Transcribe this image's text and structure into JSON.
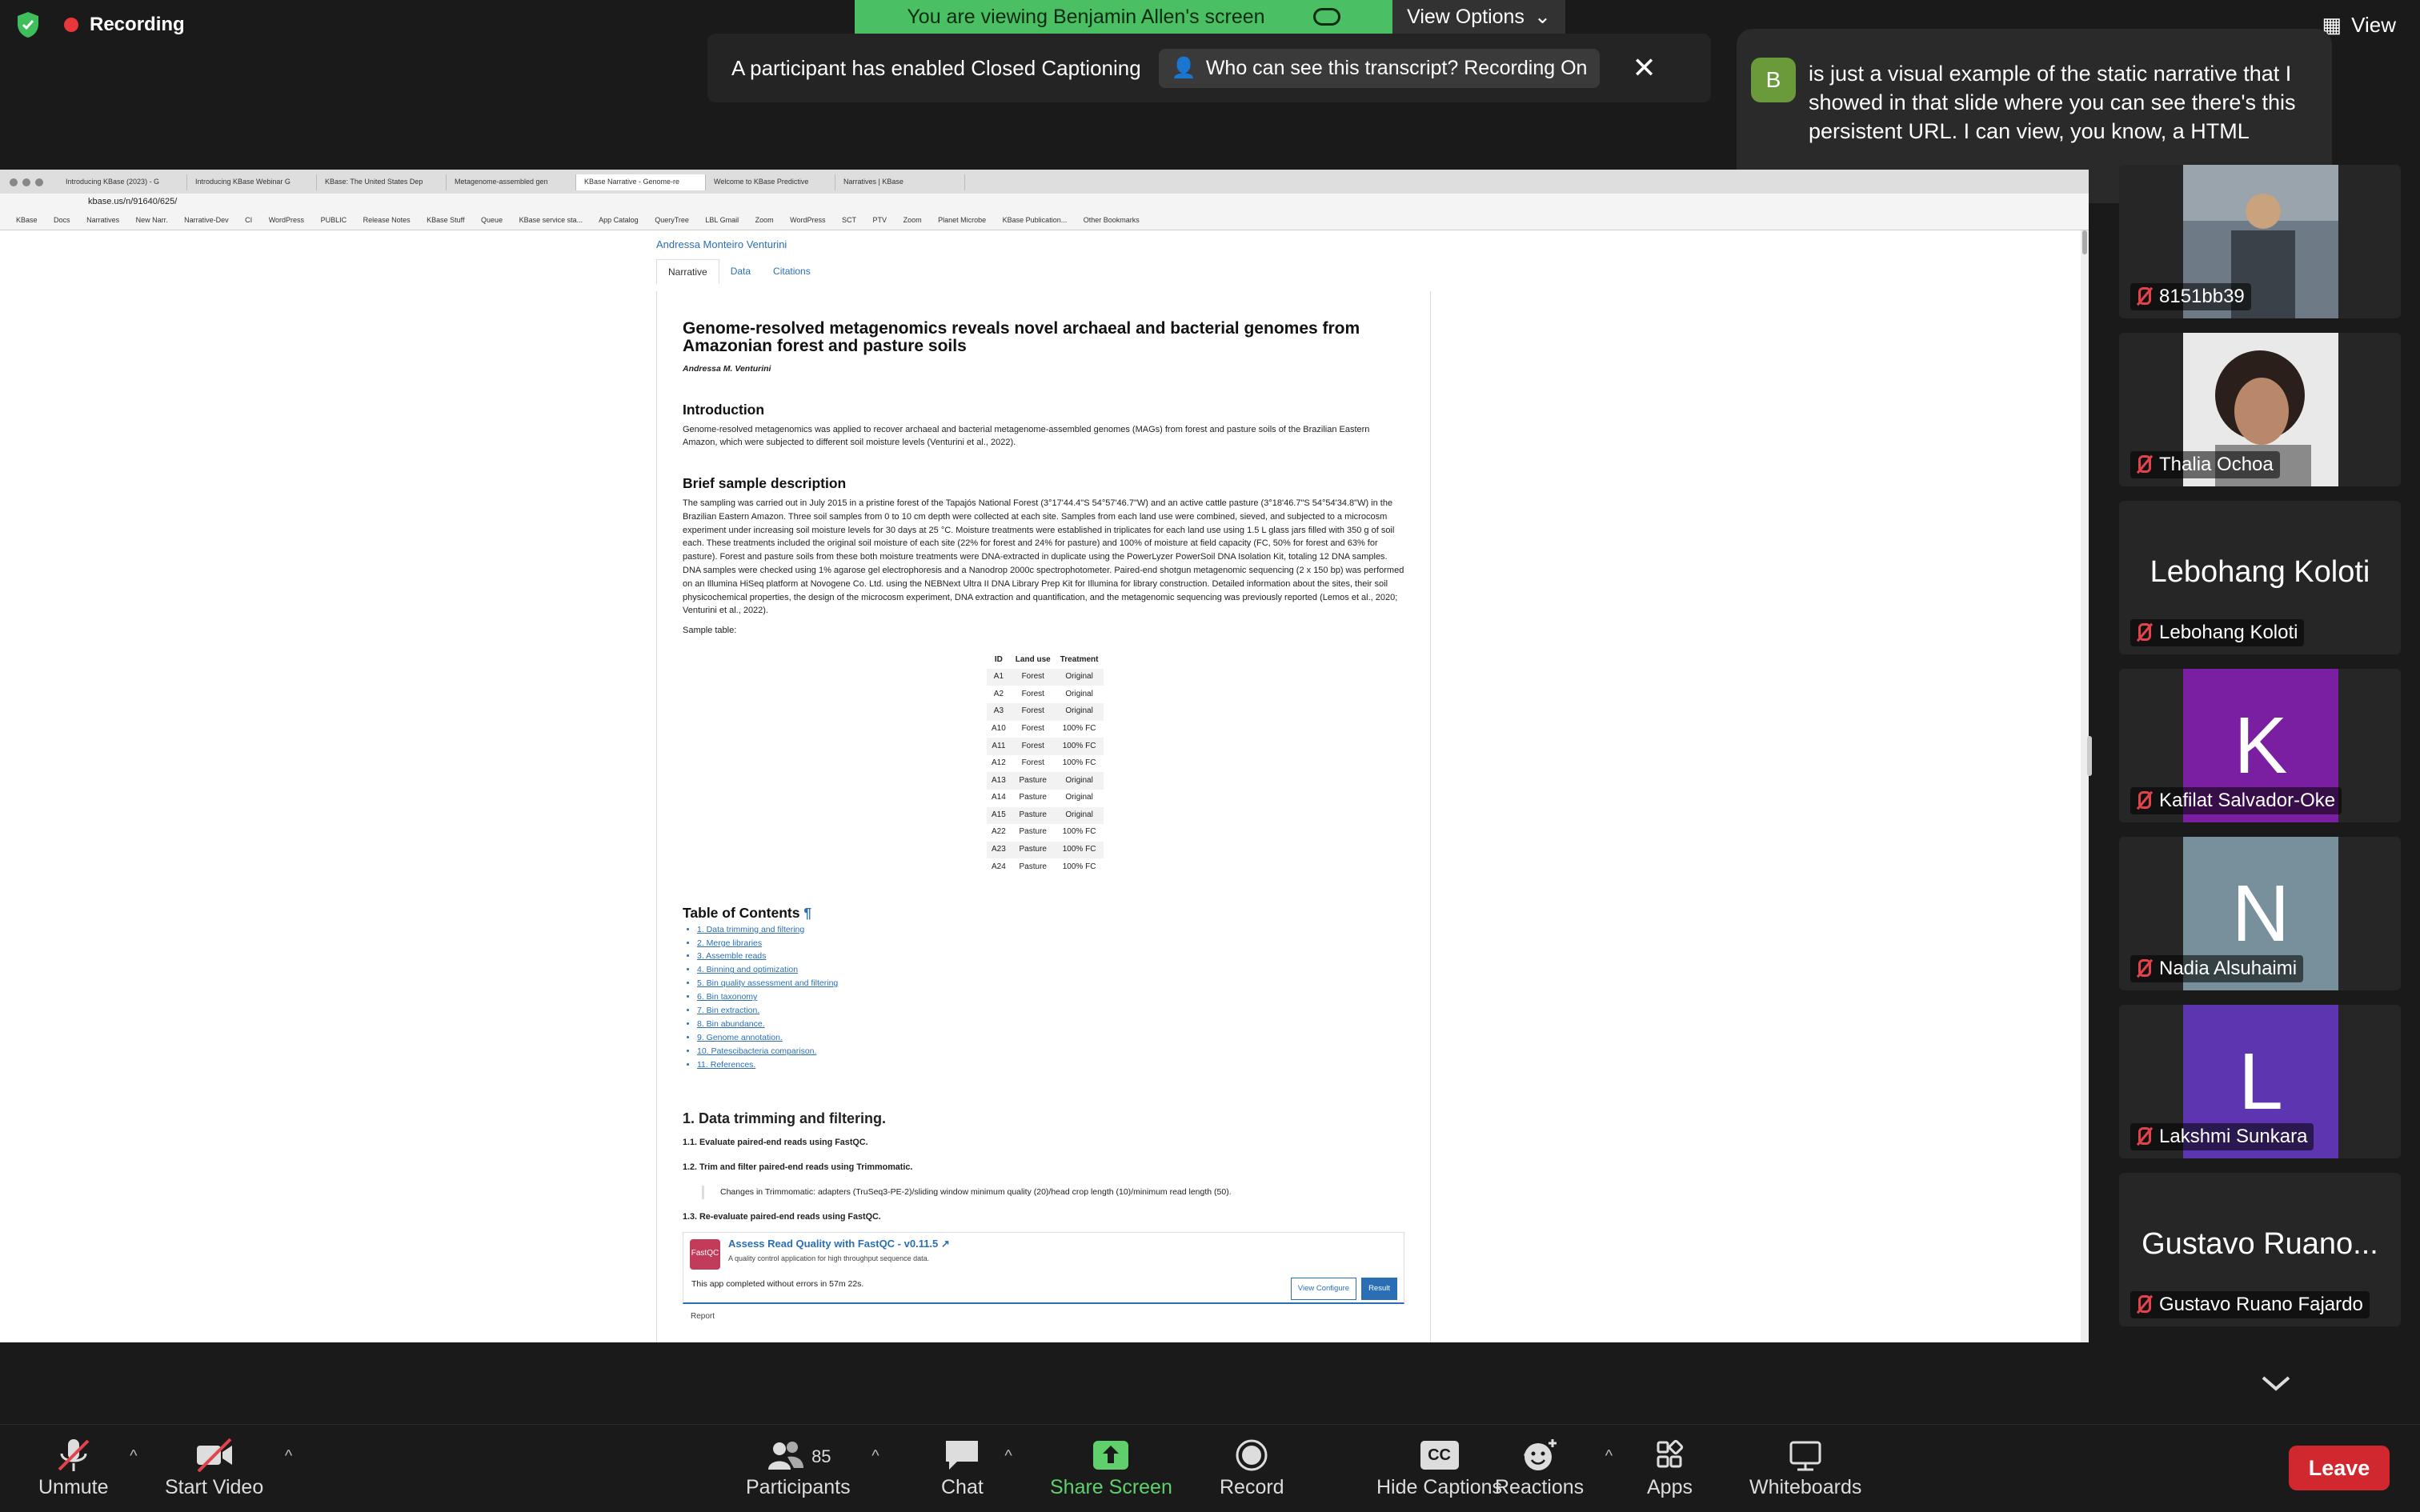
{
  "status": {
    "recording_label": "Recording"
  },
  "banner": {
    "viewing": "You are viewing Benjamin Allen's screen",
    "view_options": "View Options",
    "cc_message": "A participant has enabled Closed Captioning",
    "cc_who": "Who can see this transcript? Recording On",
    "view": "View"
  },
  "caption": {
    "initial": "B",
    "text": "is just a visual example of the static narrative that I showed in that slide where you can see there's this persistent URL. I can view, you know, a HTML"
  },
  "browser": {
    "tabs": [
      "Introducing KBase (2023) - G",
      "Introducing KBase Webinar G",
      "KBase: The United States Dep",
      "Metagenome-assembled gen",
      "KBase Narrative - Genome-re",
      "Welcome to KBase Predictive",
      "Narratives | KBase"
    ],
    "url": "kbase.us/n/91640/625/",
    "bookmarks": [
      "KBase",
      "Docs",
      "Narratives",
      "New Narr.",
      "Narrative-Dev",
      "CI",
      "WordPress",
      "PUBLIC",
      "Release Notes",
      "KBase Stuff",
      "Queue",
      "KBase service sta...",
      "App Catalog",
      "QueryTree",
      "LBL Gmail",
      "Zoom",
      "WordPress",
      "SCT",
      "PTV",
      "Zoom",
      "Planet Microbe",
      "KBase Publication...",
      "Other Bookmarks"
    ]
  },
  "narrative": {
    "author_link": "Andressa Monteiro Venturini",
    "tabs": [
      "Narrative",
      "Data",
      "Citations"
    ],
    "title": "Genome-resolved metagenomics reveals novel archaeal and bacterial genomes from Amazonian forest and pasture soils",
    "author": "Andressa M. Venturini",
    "intro_heading": "Introduction",
    "intro_text": "Genome-resolved metagenomics was applied to recover archaeal and bacterial metagenome-assembled genomes (MAGs) from forest and pasture soils of the Brazilian Eastern Amazon, which were subjected to different soil moisture levels (Venturini et al., 2022).",
    "sample_heading": "Brief sample description",
    "sample_text": "The sampling was carried out in July 2015 in a pristine forest of the Tapajós National Forest (3°17'44.4\"S 54°57'46.7\"W) and an active cattle pasture (3°18'46.7\"S 54°54'34.8\"W) in the Brazilian Eastern Amazon. Three soil samples from 0 to 10 cm depth were collected at each site. Samples from each land use were combined, sieved, and subjected to a microcosm experiment under increasing soil moisture levels for 30 days at 25 °C. Moisture treatments were established in triplicates for each land use using 1.5 L glass jars filled with 350 g of soil each. These treatments included the original soil moisture of each site (22% for forest and 24% for pasture) and 100% of moisture at field capacity (FC, 50% for forest and 63% for pasture). Forest and pasture soils from these both moisture treatments were DNA-extracted in duplicate using the PowerLyzer PowerSoil DNA Isolation Kit, totaling 12 DNA samples. DNA samples were checked using 1% agarose gel electrophoresis and a Nanodrop 2000c spectrophotometer. Paired-end shotgun metagenomic sequencing (2 x 150 bp) was performed on an Illumina HiSeq platform at Novogene Co. Ltd. using the NEBNext Ultra II DNA Library Prep Kit for Illumina for library construction. Detailed information about the sites, their soil physicochemical properties, the design of the microcosm experiment, DNA extraction and quantification, and the metagenomic sequencing was previously reported (Lemos et al., 2020; Venturini et al., 2022).",
    "sample_table_label": "Sample table:",
    "table_headers": [
      "ID",
      "Land use",
      "Treatment"
    ],
    "table_rows": [
      [
        "A1",
        "Forest",
        "Original"
      ],
      [
        "A2",
        "Forest",
        "Original"
      ],
      [
        "A3",
        "Forest",
        "Original"
      ],
      [
        "A10",
        "Forest",
        "100% FC"
      ],
      [
        "A11",
        "Forest",
        "100% FC"
      ],
      [
        "A12",
        "Forest",
        "100% FC"
      ],
      [
        "A13",
        "Pasture",
        "Original"
      ],
      [
        "A14",
        "Pasture",
        "Original"
      ],
      [
        "A15",
        "Pasture",
        "Original"
      ],
      [
        "A22",
        "Pasture",
        "100% FC"
      ],
      [
        "A23",
        "Pasture",
        "100% FC"
      ],
      [
        "A24",
        "Pasture",
        "100% FC"
      ]
    ],
    "toc_heading": "Table of Contents",
    "toc_pilcrow": "¶",
    "toc": [
      "1. Data trimming and filtering",
      "2. Merge libraries",
      "3. Assemble reads",
      "4. Binning and optimization",
      "5. Bin quality assessment and filtering",
      "6. Bin taxonomy",
      "7. Bin extraction.",
      "8. Bin abundance.",
      "9. Genome annotation.",
      "10. Patescibacteria comparison.",
      "11. References."
    ],
    "sec1_heading": "1. Data trimming and filtering.",
    "sec1_1": "1.1. Evaluate paired-end reads using FastQC.",
    "sec1_2": "1.2. Trim and filter paired-end reads using Trimmomatic.",
    "trim_note": "Changes in Trimmomatic: adapters (TruSeq3-PE-2)/sliding window minimum quality (20)/head crop length (10)/minimum read length (50).",
    "sec1_3": "1.3. Re-evaluate paired-end reads using FastQC.",
    "app": {
      "logo": "FastQC",
      "title": "Assess Read Quality with FastQC - v0.11.5",
      "subtitle": "A quality control application for high throughput sequence data.",
      "status": "This app completed without errors in 57m 22s.",
      "view_configure": "View Configure",
      "result": "Result",
      "report": "Report"
    }
  },
  "participants": [
    {
      "name": "8151bb39",
      "kind": "photo"
    },
    {
      "name": "Thalia Ochoa",
      "kind": "photo"
    },
    {
      "name": "Lebohang Koloti",
      "kind": "text",
      "display": "Lebohang Koloti"
    },
    {
      "name": "Kafilat Salvador-Oke",
      "kind": "letter",
      "letter": "K",
      "color": "#7a1fa2"
    },
    {
      "name": "Nadia Alsuhaimi",
      "kind": "letter",
      "letter": "N",
      "color": "#78909c"
    },
    {
      "name": "Lakshmi Sunkara",
      "kind": "letter",
      "letter": "L",
      "color": "#5e35b1"
    },
    {
      "name": "Gustavo Ruano Fajardo",
      "kind": "text",
      "display": "Gustavo Ruano..."
    }
  ],
  "toolbar": {
    "unmute": "Unmute",
    "start_video": "Start Video",
    "participants": "Participants",
    "participants_count": "85",
    "chat": "Chat",
    "share_screen": "Share Screen",
    "record": "Record",
    "hide_captions": "Hide Captions",
    "cc_glyph": "CC",
    "reactions": "Reactions",
    "apps": "Apps",
    "whiteboards": "Whiteboards",
    "leave": "Leave"
  },
  "colors": {
    "leave": "#d1272f",
    "share": "#5fd06c",
    "viewing_banner": "#4bbf63",
    "recording": "#e8363a"
  }
}
